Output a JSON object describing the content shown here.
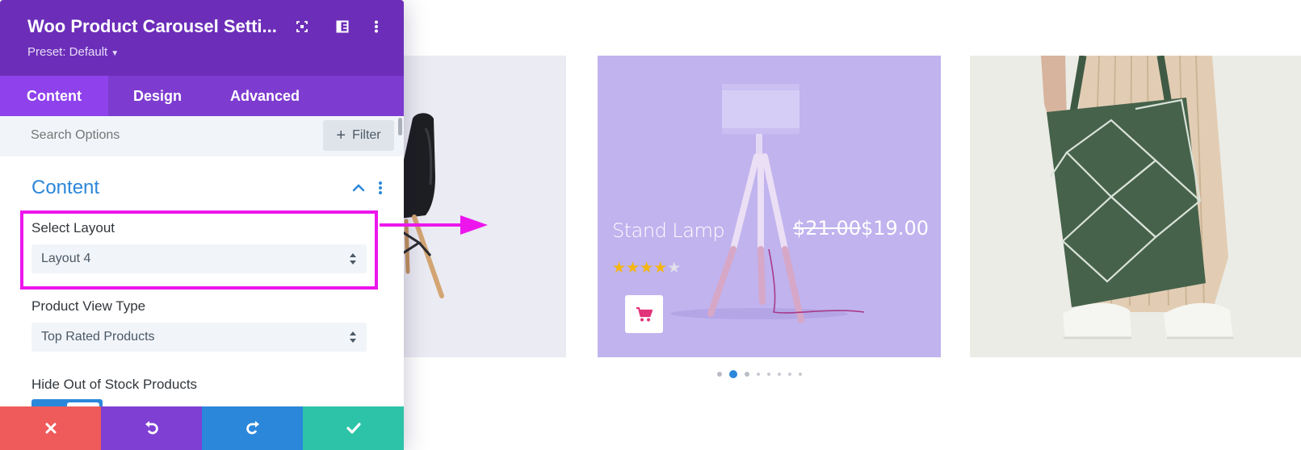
{
  "panel": {
    "title": "Woo Product Carousel Setti...",
    "preset": "Preset: Default",
    "header_icons": [
      "expand-icon",
      "sidebar-layout-icon",
      "more-vertical-icon"
    ],
    "tabs": [
      {
        "label": "Content",
        "active": true
      },
      {
        "label": "Design",
        "active": false
      },
      {
        "label": "Advanced",
        "active": false
      }
    ],
    "search_placeholder": "Search Options",
    "filter_label": "Filter",
    "section_title": "Content",
    "fields": {
      "select_layout": {
        "label": "Select Layout",
        "value": "Layout 4"
      },
      "product_view_type": {
        "label": "Product View Type",
        "value": "Top Rated Products"
      },
      "hide_out_of_stock": {
        "label": "Hide Out of Stock Products",
        "enabled": true
      }
    },
    "footer_actions": [
      "close-icon",
      "undo-icon",
      "redo-icon",
      "check-icon"
    ],
    "colors": {
      "header": "#6c2eb9",
      "tabs": "#7e3bd0",
      "active_tab": "#8f42ec",
      "accent_blue": "#2b87da",
      "highlight": "#ec16ec",
      "footer_close": "#ef5b5b",
      "footer_undo": "#7f3fd3",
      "footer_redo": "#2b87da",
      "footer_save": "#2cc3a8"
    }
  },
  "carousel": {
    "featured_product": {
      "name": "Stand Lamp",
      "old_price": "$21.00",
      "price": "$19.00",
      "rating": 4,
      "rating_max": 5
    },
    "dots_count": 8,
    "active_dot": 2,
    "colors": {
      "lamp_card": "#c0b3ee",
      "star": "#f5b60f",
      "cart_icon": "#e2327a"
    }
  }
}
